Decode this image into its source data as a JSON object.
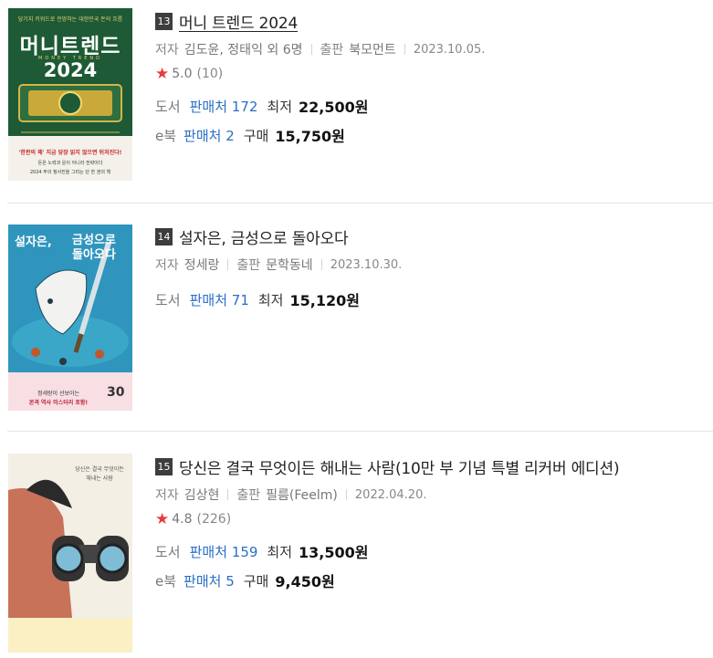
{
  "books": [
    {
      "rank": "13",
      "title": "머니 트렌드 2024",
      "author_label": "저자",
      "author": "김도윤, 정태익 외 6명",
      "publisher_label": "출판",
      "publisher": "북모먼트",
      "date": "2023.10.05.",
      "rating": "5.0",
      "rating_count": "(10)",
      "print_label": "도서",
      "print_sellers": "판매처 172",
      "print_price_label": "최저",
      "print_price": "22,500원",
      "ebook_label": "e북",
      "ebook_sellers": "판매처 2",
      "ebook_price_label": "구매",
      "ebook_price": "15,750원",
      "cover": {
        "top_text": "당기지 키워드로 전망하는 대한민국 돈의 흐름",
        "title": "머니트렌드",
        "sub": "MONEY TREND",
        "year": "2024",
        "banner": "'한판의 해' 지금 당장 읽지 않으면 뒤처진다!",
        "blurb1": "돈은 노력과 운이 아니라 전략이다",
        "blurb2": "2024 부의 청사진을 그리는 단 한 권의 책"
      }
    },
    {
      "rank": "14",
      "title": "설자은, 금성으로 돌아오다",
      "author_label": "저자",
      "author": "정세랑",
      "publisher_label": "출판",
      "publisher": "문학동네",
      "date": "2023.10.30.",
      "print_label": "도서",
      "print_sellers": "판매처 71",
      "print_price_label": "최저",
      "print_price": "15,120원",
      "cover": {
        "title1": "설자은,",
        "title2": "금성으로",
        "title3": "돌아오다",
        "band1": "정세랑이 선보이는",
        "band2": "본격 역사 미스터리 포함!",
        "badge": "30"
      }
    },
    {
      "rank": "15",
      "title": "당신은 결국 무엇이든 해내는 사람(10만 부 기념 특별 리커버 에디션)",
      "author_label": "저자",
      "author": "김상현",
      "publisher_label": "출판",
      "publisher": "필름(Feelm)",
      "date": "2022.04.20.",
      "rating": "4.8",
      "rating_count": "(226)",
      "print_label": "도서",
      "print_sellers": "판매처 159",
      "print_price_label": "최저",
      "print_price": "13,500원",
      "ebook_label": "e북",
      "ebook_sellers": "판매처 5",
      "ebook_price_label": "구매",
      "ebook_price": "9,450원",
      "cover": {
        "title1": "당신은 결국 무엇이든",
        "title2": "해내는 사람"
      }
    }
  ],
  "colors": {
    "link": "#2a6fc5",
    "star": "#e83a3a",
    "rank_bg": "#3d3d3d"
  }
}
